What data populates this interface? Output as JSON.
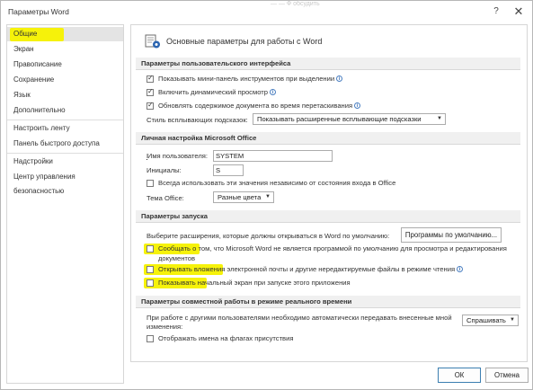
{
  "window": {
    "title": "Параметры Word",
    "help_glyph": "?",
    "close_glyph": "✕",
    "ghost_text": "— — Ф  обсудить"
  },
  "sidebar": {
    "items": [
      {
        "label": "Общие",
        "active": true
      },
      {
        "label": "Экран"
      },
      {
        "label": "Правописание"
      },
      {
        "label": "Сохранение"
      },
      {
        "label": "Язык"
      },
      {
        "label": "Дополнительно"
      },
      {
        "label": "Настроить ленту"
      },
      {
        "label": "Панель быстрого доступа"
      },
      {
        "label": "Надстройки"
      },
      {
        "label": "Центр управления безопасностью"
      }
    ]
  },
  "main": {
    "header_title": "Основные параметры для работы с Word",
    "ui_section": {
      "title": "Параметры пользовательского интерфейса",
      "options": [
        {
          "label": "Показывать мини-панель инструментов при выделении",
          "checked": true
        },
        {
          "label": "Включить динамический просмотр",
          "checked": true
        },
        {
          "label": "Обновлять содержимое документа во время перетаскивания",
          "checked": true
        }
      ],
      "tooltip_style_label": "Стиль всплывающих подсказок:",
      "tooltip_style_value": "Показывать расширенные всплывающие подсказки"
    },
    "personal_section": {
      "title": "Личная настройка Microsoft Office",
      "username_label": "Имя пользователя:",
      "username_value": "SYSTEM",
      "initials_label": "Инициалы:",
      "initials_value": "S",
      "always_use_label": "Всегда использовать эти значения независимо от состояния входа в Office",
      "theme_label": "Тема Office:",
      "theme_value": "Разные цвета"
    },
    "startup_section": {
      "title": "Параметры запуска",
      "extensions_label": "Выберите расширения, которые должны открываться в Word по умолчанию:",
      "defaults_button": "Программы по умолчанию...",
      "options": [
        {
          "label_line1": "Сообщать о том, что Microsoft Word не является программой по умолчанию для просмотра и редактирования",
          "label_line2": "документов",
          "checked": false
        },
        {
          "label_line1": "Открывать вложения электронной почты и другие нередактируемые файлы в режиме чтения",
          "checked": false
        },
        {
          "label_line1": "Показывать начальный экран при запуске этого приложения",
          "checked": false
        }
      ]
    },
    "coauth_section": {
      "title": "Параметры совместной работы в режиме реального времени",
      "share_label_line1": "При работе с другими пользователями необходимо автоматически передавать внесенные мной",
      "share_label_line2": "изменения:",
      "share_value": "Спрашивать",
      "show_names_label": "Отображать имена на флагах присутствия"
    }
  },
  "footer": {
    "ok_label": "ОК",
    "cancel_label": "Отмена"
  },
  "colors": {
    "highlight": "#f6f20a",
    "info_icon": "#2b64b0",
    "primary_border": "#3c7fb1"
  }
}
